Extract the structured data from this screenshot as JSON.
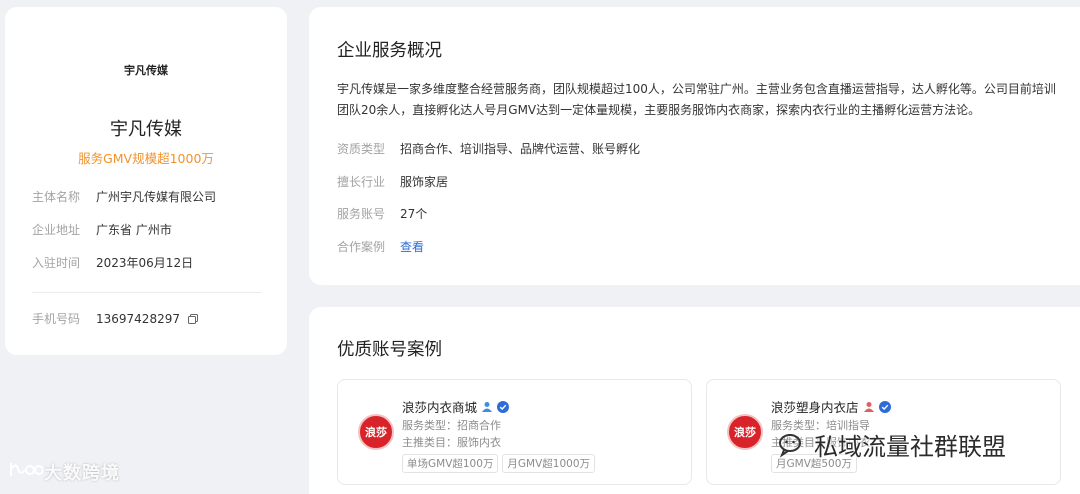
{
  "profile": {
    "logo_text": "宇凡传媒",
    "name": "宇凡传媒",
    "gmv": "服务GMV规模超1000万",
    "info": [
      {
        "label": "主体名称",
        "value": "广州宇凡传媒有限公司"
      },
      {
        "label": "企业地址",
        "value": "广东省 广州市"
      },
      {
        "label": "入驻时间",
        "value": "2023年06月12日"
      }
    ],
    "phone": {
      "label": "手机号码",
      "value": "13697428297"
    }
  },
  "overview": {
    "title": "企业服务概况",
    "description": "宇凡传媒是一家多维度整合经营服务商，团队规模超过100人，公司常驻广州。主营业务包含直播运营指导，达人孵化等。公司目前培训团队20余人，直接孵化达人号月GMV达到一定体量规模，主要服务服饰内衣商家，探索内衣行业的主播孵化运营方法论。",
    "rows": [
      {
        "label": "资质类型",
        "value": "招商合作、培训指导、品牌代运营、账号孵化"
      },
      {
        "label": "擅长行业",
        "value": "服饰家居"
      },
      {
        "label": "服务账号",
        "value": "27个"
      },
      {
        "label": "合作案例",
        "value": "查看"
      }
    ]
  },
  "cases": {
    "title": "优质账号案例",
    "items": [
      {
        "name": "浪莎内衣商城",
        "logo_text": "浪莎",
        "type_label": "服务类型：",
        "type_value": "招商合作",
        "cat_label": "主推类目：",
        "cat_value": "服饰内衣",
        "tags": [
          "单场GMV超100万",
          "月GMV超1000万"
        ],
        "person_color": "#3b8ee0"
      },
      {
        "name": "浪莎塑身内衣店",
        "logo_text": "浪莎",
        "type_label": "服务类型：",
        "type_value": "培训指导",
        "cat_label": "主推类目：",
        "cat_value": "服饰内衣",
        "tags": [
          "月GMV超500万"
        ],
        "person_color": "#e06060"
      }
    ]
  },
  "watermarks": {
    "left": "大数跨境",
    "right": "私域流量社群联盟"
  }
}
